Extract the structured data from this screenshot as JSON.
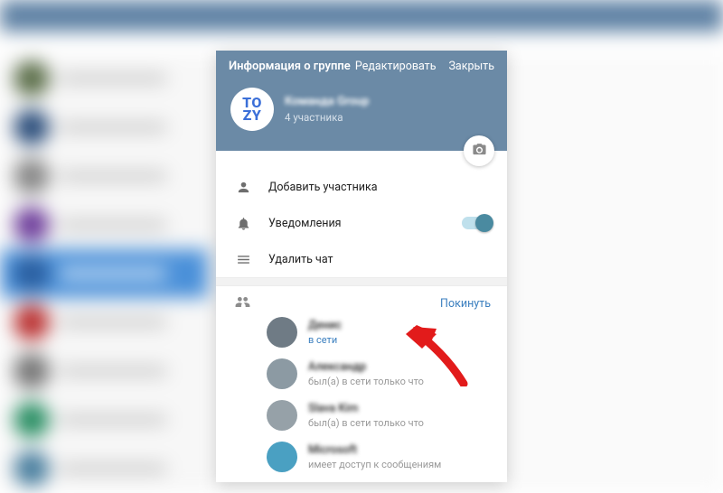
{
  "dialog": {
    "title": "Информация о группе",
    "edit": "Редактировать",
    "close": "Закрыть",
    "group_avatar_glyph": "TO\nZY",
    "group_name": "Команда Group",
    "group_sub": "4 участника"
  },
  "menu": {
    "add_member": "Добавить участника",
    "notifications": "Уведомления",
    "delete_chat": "Удалить чат"
  },
  "members": {
    "leave": "Покинуть",
    "list": [
      {
        "name": "Денис",
        "status": "в сети",
        "online": true,
        "color": "#6f7b85"
      },
      {
        "name": "Александр",
        "status": "был(а) в сети только что",
        "online": false,
        "color": "#8c9aa3"
      },
      {
        "name": "Slava Kim",
        "status": "был(а) в сети только что",
        "online": false,
        "color": "#96a1a8"
      },
      {
        "name": "Microsoft",
        "status": "имеет доступ к сообщениям",
        "online": false,
        "color": "#4aa0c2"
      }
    ]
  },
  "bg_rows": [
    {
      "c": "#5c6f4a"
    },
    {
      "c": "#2d4f7c"
    },
    {
      "c": "#888"
    },
    {
      "c": "#6f3f9c"
    },
    {
      "c": "#2b5fa0",
      "sel": true
    },
    {
      "c": "#b33"
    },
    {
      "c": "#777"
    },
    {
      "c": "#2a8f64"
    },
    {
      "c": "#4a7f9f"
    }
  ]
}
